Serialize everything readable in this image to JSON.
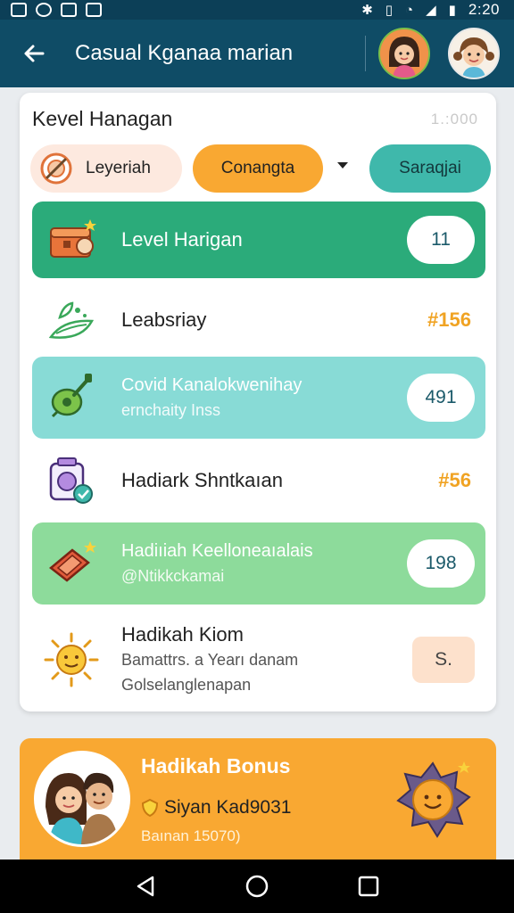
{
  "status_bar": {
    "time": "2:20",
    "icons": [
      "bluetooth-icon",
      "vibrate-icon",
      "wifi-icon",
      "signal-icon",
      "battery-icon"
    ]
  },
  "app_bar": {
    "title": "Casual Kganaa marian",
    "back_icon": "arrow-left-icon"
  },
  "main_card": {
    "title": "Kevel Hanagan",
    "count": "1.:000",
    "filters": [
      {
        "label": "Leyeriah",
        "icon": "target-icon",
        "color": "#fde9df"
      },
      {
        "label": "Conangta",
        "color": "#f9a832"
      },
      {
        "label": "Saraqjai",
        "color": "#3fb8ab"
      }
    ],
    "items": [
      {
        "title": "Level Harigan",
        "badge": "11",
        "icon": "treasure-chest-icon",
        "color": "#2bab7a"
      },
      {
        "title": "Leabsriay",
        "value": "#156",
        "icon": "herb-leaf-icon"
      },
      {
        "title": "Covid Kanalokwenihay",
        "subtitle": "ernchaity Inss",
        "badge": "491",
        "icon": "guitar-icon",
        "color": "#88dbd6"
      },
      {
        "title": "Hadiark Shntkaıan",
        "value": "#56",
        "icon": "camera-icon"
      },
      {
        "title": "Hadiıiah Keelloneaıalais",
        "subtitle": "@Ntikkckamai",
        "badge": "198",
        "icon": "tag-icon",
        "color": "#8ddb9b"
      },
      {
        "title": "Hadikah Kiom",
        "subtitle": "Bamattrs. a Yearı danam",
        "subtitle2": "Golselanglenapan",
        "badge": "S.",
        "icon": "sun-icon"
      }
    ]
  },
  "bonus": {
    "title": "Hadikah Bonus",
    "line": "Siyan Kad9031",
    "sub": "Baınan 15070)",
    "color": "#f9a832"
  },
  "nav": {
    "back": "nav-back-icon",
    "home": "nav-home-icon",
    "recents": "nav-recents-icon"
  }
}
